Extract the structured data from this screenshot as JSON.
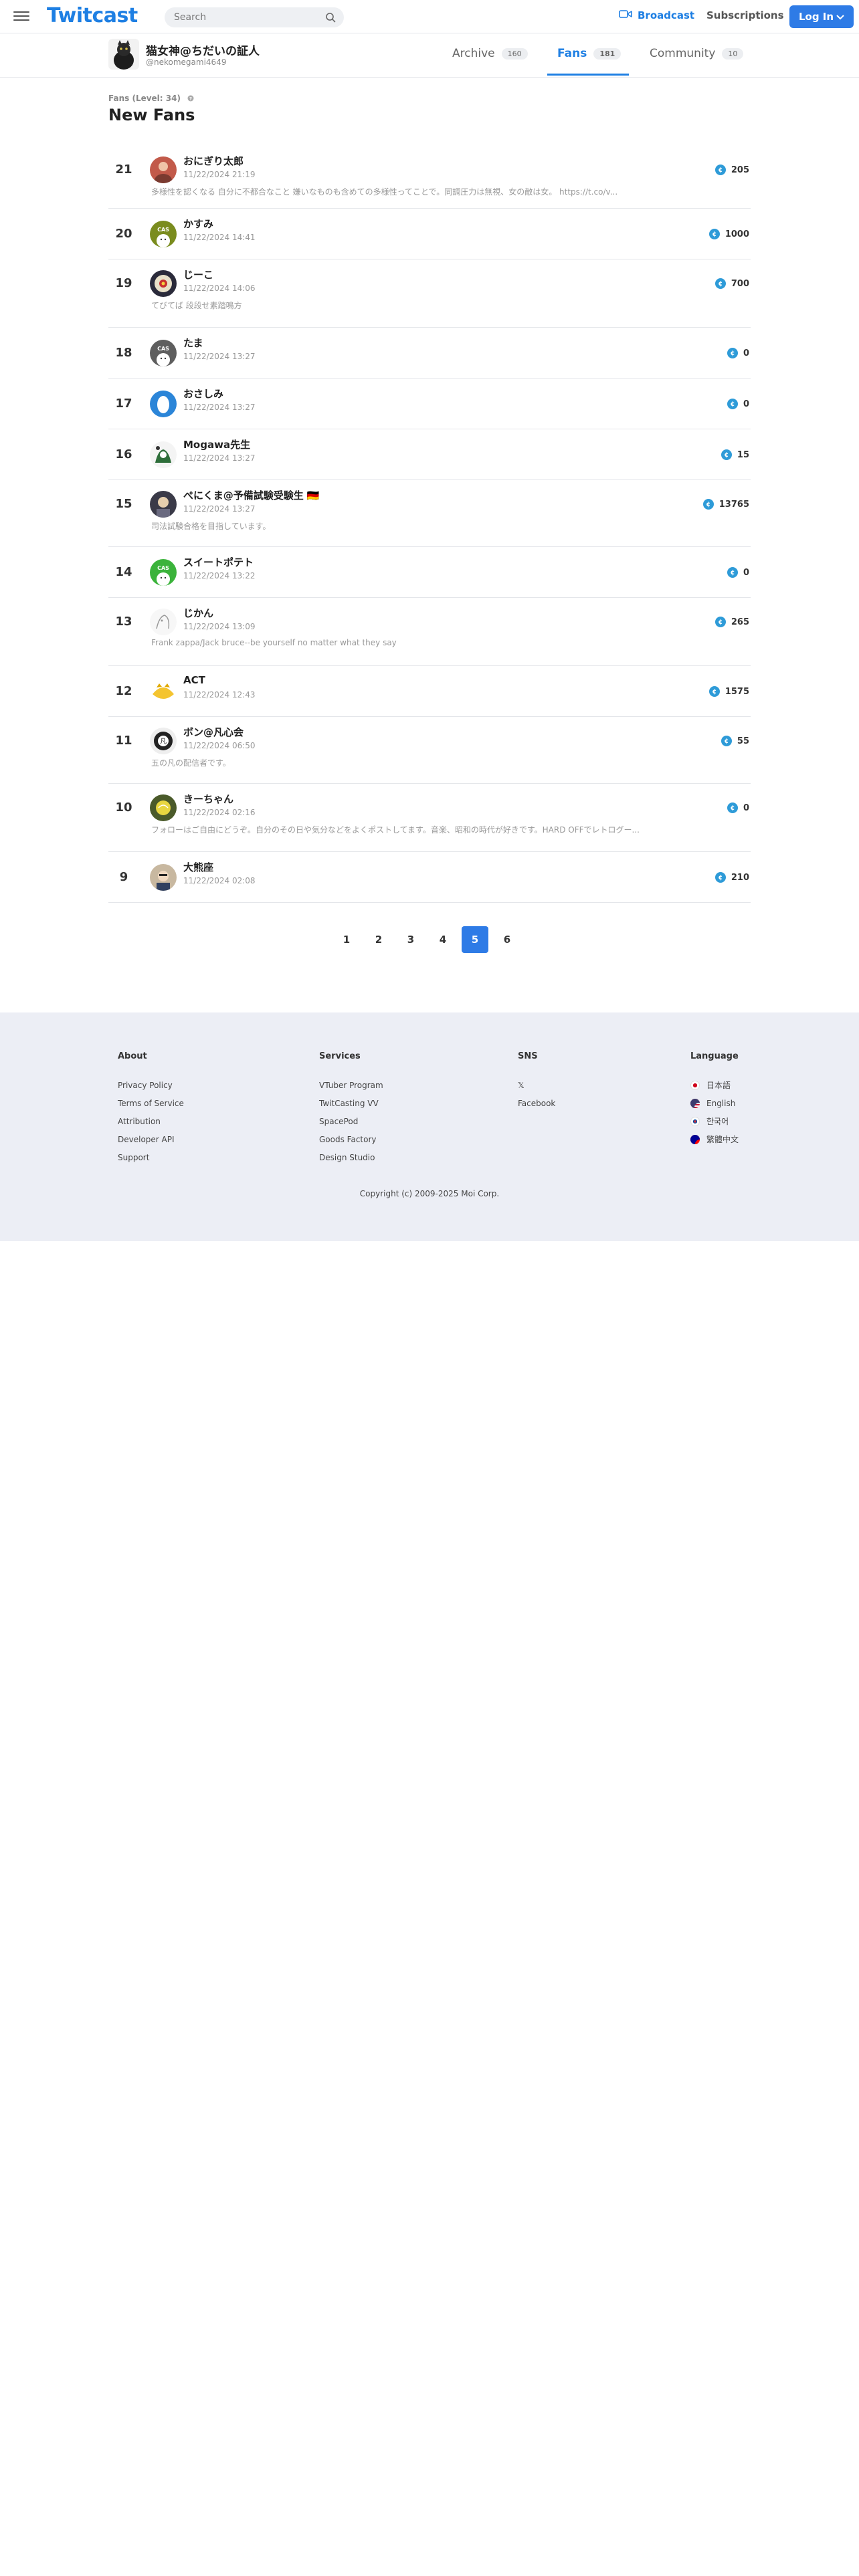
{
  "header": {
    "logo": "Twitcast",
    "search_placeholder": "Search",
    "broadcast_label": "Broadcast",
    "subscriptions_label": "Subscriptions",
    "login_label": "Log In",
    "accent_color": "#2e7be6"
  },
  "profile": {
    "name": "猫女神@ちだいの証人",
    "handle": "@nekomegami4649",
    "tabs": [
      {
        "label": "Archive",
        "count": "160"
      },
      {
        "label": "Fans",
        "count": "181"
      },
      {
        "label": "Community",
        "count": "10"
      }
    ],
    "active_tab": "Fans"
  },
  "main": {
    "level_label": "Fans (Level: 34)",
    "title": "New Fans"
  },
  "fans": [
    {
      "rank": "21",
      "name": "おにぎり太郎",
      "date": "11/22/2024 21:19",
      "comment": "多様性を認くなる 自分に不都合なこと 嫌いなものも含めての多様性ってことで。同調圧力は無視、女の敵は女。 https://t.co/v...",
      "score": "205"
    },
    {
      "rank": "20",
      "name": "かすみ",
      "date": "11/22/2024 14:41",
      "comment": "",
      "score": "1000"
    },
    {
      "rank": "19",
      "name": "じーこ",
      "date": "11/22/2024 14:06",
      "comment": "てびてば 段段せ素踏鳴方",
      "score": "700"
    },
    {
      "rank": "18",
      "name": "たま",
      "date": "11/22/2024 13:27",
      "comment": "",
      "score": "0"
    },
    {
      "rank": "17",
      "name": "おさしみ",
      "date": "11/22/2024 13:27",
      "comment": "",
      "score": "0"
    },
    {
      "rank": "16",
      "name": "Mogawa先生",
      "date": "11/22/2024 13:27",
      "comment": "",
      "score": "15"
    },
    {
      "rank": "15",
      "name": "ぺにくま@予備試験受験生 🇩🇪",
      "date": "11/22/2024 13:27",
      "comment": "司法試験合格を目指しています。",
      "score": "13765"
    },
    {
      "rank": "14",
      "name": "スイートポテト",
      "date": "11/22/2024 13:22",
      "comment": "",
      "score": "0"
    },
    {
      "rank": "13",
      "name": "じかん",
      "date": "11/22/2024 13:09",
      "comment": "Frank zappa/Jack bruce--be yourself no matter what they say",
      "score": "265"
    },
    {
      "rank": "12",
      "name": "ACT",
      "date": "11/22/2024 12:43",
      "comment": "",
      "score": "1575"
    },
    {
      "rank": "11",
      "name": "ボン@凡心会",
      "date": "11/22/2024 06:50",
      "comment": "五の凡の配信者です。",
      "score": "55"
    },
    {
      "rank": "10",
      "name": "きーちゃん",
      "date": "11/22/2024 02:16",
      "comment": "フォローはご自由にどうぞ。自分のその日や気分などをよくポストしてます。音楽、昭和の時代が好きです。HARD OFFでレトログー...",
      "score": "0"
    },
    {
      "rank": "9",
      "name": "大熊座",
      "date": "11/22/2024 02:08",
      "comment": "",
      "score": "210"
    }
  ],
  "pagination": {
    "pages": [
      "1",
      "2",
      "3",
      "4",
      "5",
      "6"
    ],
    "current": "5"
  },
  "footer": {
    "about": {
      "heading": "About",
      "links": [
        "Privacy Policy",
        "Terms of Service",
        "Attribution",
        "Developer API",
        "Support"
      ]
    },
    "services": {
      "heading": "Services",
      "links": [
        "VTuber Program",
        "TwitCasting VV",
        "SpacePod",
        "Goods Factory",
        "Design Studio"
      ]
    },
    "sns": {
      "heading": "SNS",
      "links": [
        "𝕏",
        "Facebook"
      ]
    },
    "language": {
      "heading": "Language",
      "links": [
        "日本語",
        "English",
        "한국어",
        "繁體中文"
      ]
    },
    "copyright": "Copyright (c) 2009-2025 Moi Corp."
  }
}
